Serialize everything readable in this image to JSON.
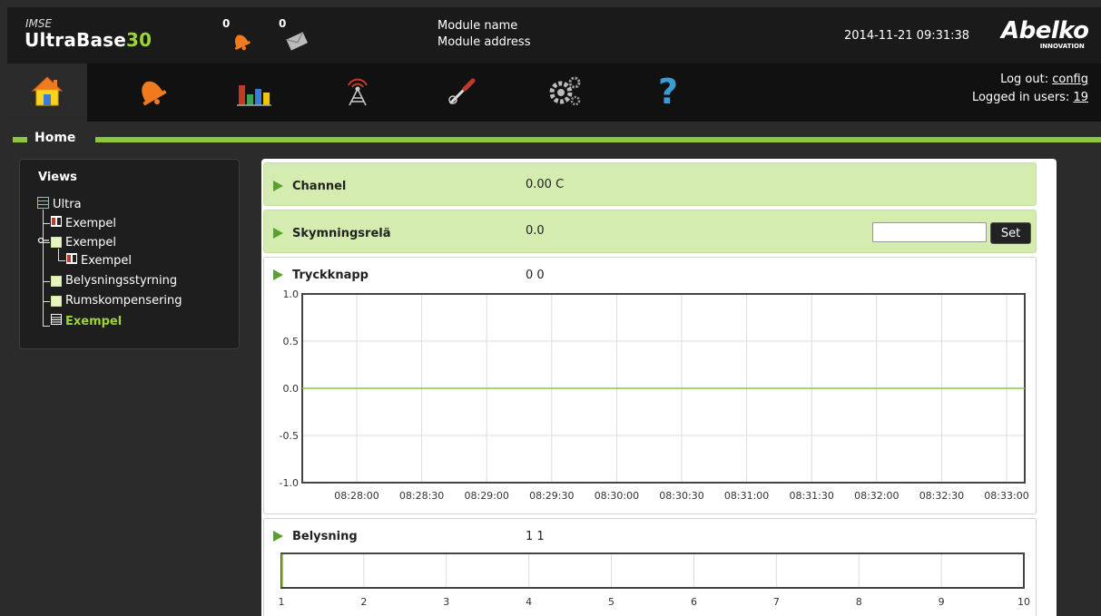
{
  "header": {
    "brand_small": "IMSE",
    "brand_main": "UltraBase",
    "brand_num": "30",
    "alarm_count": "0",
    "message_count": "0",
    "module_name": "Module name",
    "module_address": "Module address",
    "datetime": "2014-11-21 09:31:38",
    "logo_main": "Abelko",
    "logo_sub": "INNOVATION"
  },
  "nav": {
    "logout_label": "Log out: ",
    "logout_user": "config",
    "logged_label": "Logged in users: ",
    "logged_count": "19"
  },
  "section": {
    "title": "Home"
  },
  "views": {
    "title": "Views",
    "root": "Ultra",
    "items": [
      "Exempel",
      "Exempel",
      "Exempel",
      "Belysningsstyrning",
      "Rumskompensering",
      "Exempel"
    ]
  },
  "cards": [
    {
      "name": "Channel",
      "value": "0.00 C"
    },
    {
      "name": "Skymningsrelä",
      "value": "0.0",
      "button": "Set",
      "input_value": ""
    },
    {
      "name": "Tryckknapp",
      "value": "0 0"
    },
    {
      "name": "Belysning",
      "value": "1 1"
    }
  ],
  "chart_data": [
    {
      "type": "line",
      "x": [
        "08:28:00",
        "08:28:30",
        "08:29:00",
        "08:29:30",
        "08:30:00",
        "08:30:30",
        "08:31:00",
        "08:31:30",
        "08:32:00",
        "08:32:30",
        "08:33:00"
      ],
      "series": [
        {
          "values": [
            0,
            0,
            0,
            0,
            0,
            0,
            0,
            0,
            0,
            0,
            0
          ]
        }
      ],
      "y_ticks": [
        "1.0",
        "0.5",
        "0.0",
        "-0.5",
        "-1.0"
      ],
      "ylim": [
        -1.0,
        1.0
      ],
      "grid": true,
      "line_color": "#8dc63f"
    },
    {
      "type": "bar",
      "x_ticks": [
        "1",
        "2",
        "3",
        "4",
        "5",
        "6",
        "7",
        "8",
        "9",
        "10"
      ],
      "xlim": [
        1,
        10
      ],
      "value": 1,
      "grid": true
    }
  ]
}
